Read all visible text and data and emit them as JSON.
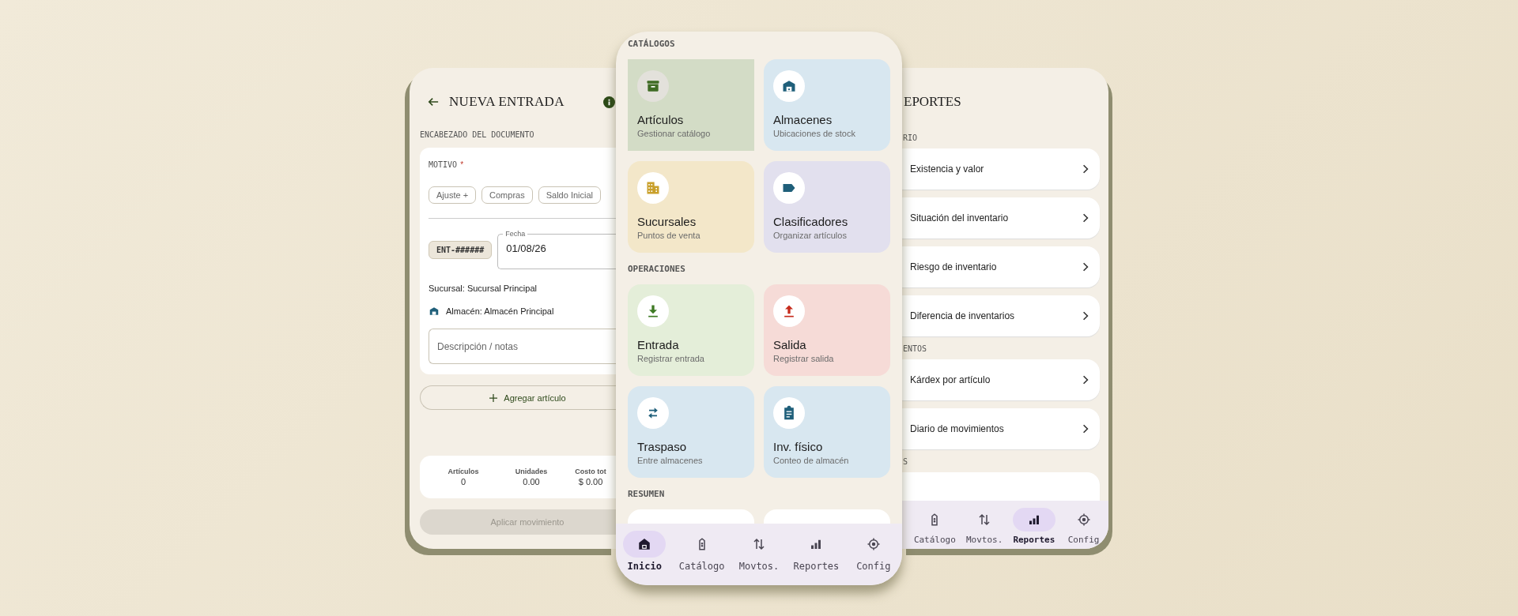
{
  "entry_screen": {
    "title": "NUEVA ENTRADA",
    "section_label": "ENCABEZADO DEL DOCUMENTO",
    "motivo": {
      "label": "MOTIVO",
      "required_mark": "*"
    },
    "reasons": [
      {
        "label": "Ajuste +",
        "selected": false
      },
      {
        "label": "Compras",
        "selected": false
      },
      {
        "label": "Saldo Inicial",
        "selected": false
      }
    ],
    "folio": "ENT-######",
    "date_field": {
      "label": "Fecha",
      "value": "01/08/26"
    },
    "branch_text": "Sucursal: Sucursal Principal",
    "warehouse_text": "Almacén: Almacén Principal",
    "notes_field": {
      "placeholder": "Descripción / notas"
    },
    "add_button": "Agregar artículo",
    "summary": [
      {
        "label": "Artículos",
        "value": "0"
      },
      {
        "label": "Unidades",
        "value": "0.00"
      },
      {
        "label": "Costo tot",
        "value": "$ 0.00"
      }
    ],
    "apply_button": {
      "label": "Aplicar movimiento",
      "disabled": true
    }
  },
  "home_screen": {
    "sections": [
      {
        "heading": "CATÁLOGOS",
        "kind": "grid",
        "tiles": [
          {
            "kind": "archive",
            "title": "Artículos",
            "subtitle": "Gestionar catálogo",
            "color": "#d3dcc6",
            "selected": true
          },
          {
            "kind": "warehouse",
            "title": "Almacenes",
            "subtitle": "Ubicaciones de stock",
            "color": "#d8e7f0",
            "selected": false
          },
          {
            "kind": "building",
            "title": "Sucursales",
            "subtitle": "Puntos de venta",
            "color": "#f3e7c9",
            "selected": false
          },
          {
            "kind": "tag",
            "title": "Clasificadores",
            "subtitle": "Organizar artículos",
            "color": "#e2e0ee",
            "selected": false
          }
        ]
      },
      {
        "heading": "OPERACIONES",
        "kind": "grid",
        "tiles": [
          {
            "kind": "download",
            "title": "Entrada",
            "subtitle": "Registrar entrada",
            "color": "#e4eed9",
            "selected": false
          },
          {
            "kind": "upload",
            "title": "Salida",
            "subtitle": "Registrar salida",
            "color": "#f6dbd7",
            "selected": false
          },
          {
            "kind": "swap",
            "title": "Traspaso",
            "subtitle": "Entre almacenes",
            "color": "#d8e7f0",
            "selected": false
          },
          {
            "kind": "clipboard",
            "title": "Inv. físico",
            "subtitle": "Conteo de almacén",
            "color": "#d8e7f0",
            "selected": false
          }
        ]
      },
      {
        "heading": "RESUMEN",
        "kind": "peek"
      }
    ],
    "nav": [
      {
        "kind": "home",
        "label": "Inicio",
        "selected": true
      },
      {
        "kind": "catalog",
        "label": "Catálogo",
        "selected": false
      },
      {
        "kind": "moves",
        "label": "Movtos.",
        "selected": false
      },
      {
        "kind": "reports",
        "label": "Reportes",
        "selected": false
      },
      {
        "kind": "config",
        "label": "Config",
        "selected": false
      }
    ]
  },
  "reports_screen": {
    "title": "EPORTES",
    "sections": [
      {
        "heading": "RIO",
        "kind": "list",
        "items": [
          "Existencia y valor",
          "Situación del inventario",
          "Riesgo de inventario",
          "Diferencia de inventarios"
        ]
      },
      {
        "heading": "ENTOS",
        "kind": "list",
        "items": [
          "Kárdex por artículo",
          "Diario de movimientos"
        ]
      },
      {
        "heading": "S",
        "kind": "peek"
      }
    ],
    "nav": [
      {
        "kind": "catalog",
        "label": "Catálogo",
        "selected": false
      },
      {
        "kind": "moves",
        "label": "Movtos.",
        "selected": false
      },
      {
        "kind": "reports",
        "label": "Reportes",
        "selected": true
      },
      {
        "kind": "config",
        "label": "Config",
        "selected": false
      }
    ]
  }
}
